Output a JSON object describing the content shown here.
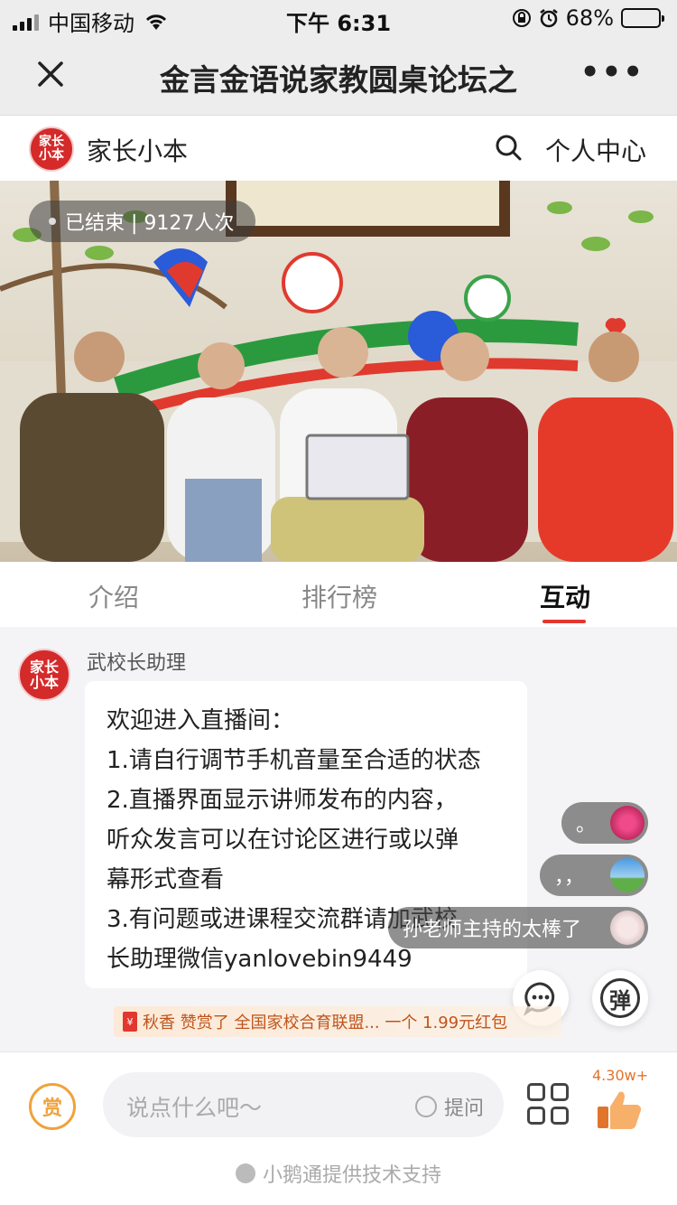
{
  "status_bar": {
    "carrier": "中国移动",
    "time": "下午 6:31",
    "battery": "68%",
    "battery_level": 0.68
  },
  "nav": {
    "title": "金言金语说家教圆桌论坛之",
    "more": "•••"
  },
  "brand": {
    "logo_line1": "家长",
    "logo_line2": "小本",
    "name": "家长小本",
    "personal_center": "个人中心"
  },
  "video": {
    "status": "已结束 | 9127人次"
  },
  "tabs": [
    {
      "label": "介绍"
    },
    {
      "label": "排行榜"
    },
    {
      "label": "互动"
    }
  ],
  "chat": {
    "sender": "武校长助理",
    "message_lines": [
      "欢迎进入直播间：",
      "1.请自行调节手机音量至合适的状态",
      "2.直播界面显示讲师发布的内容，",
      "听众发言可以在讨论区进行或以弹",
      "幕形式查看",
      "3.有问题或进课程交流群请加武校",
      "长助理微信yanlovebin9449"
    ],
    "danmaku": [
      {
        "text": "。"
      },
      {
        "text": "，，"
      },
      {
        "text": "孙老师主持的太棒了"
      }
    ],
    "comment_btn": "…",
    "danmaku_btn": "弹",
    "reward_banner": {
      "icon": "¥",
      "text": "秋香 赞赏了 全国家校合育联盟... 一个 1.99元红包"
    }
  },
  "bottom": {
    "reward_btn": "赏",
    "input_placeholder": "说点什么吧～",
    "ask_label": "提问",
    "like_count": "4.30w+",
    "footer_text": "小鹅通提供技术支持"
  },
  "colors": {
    "accent_red": "#e2372f",
    "reward_orange": "#f0a23a"
  }
}
